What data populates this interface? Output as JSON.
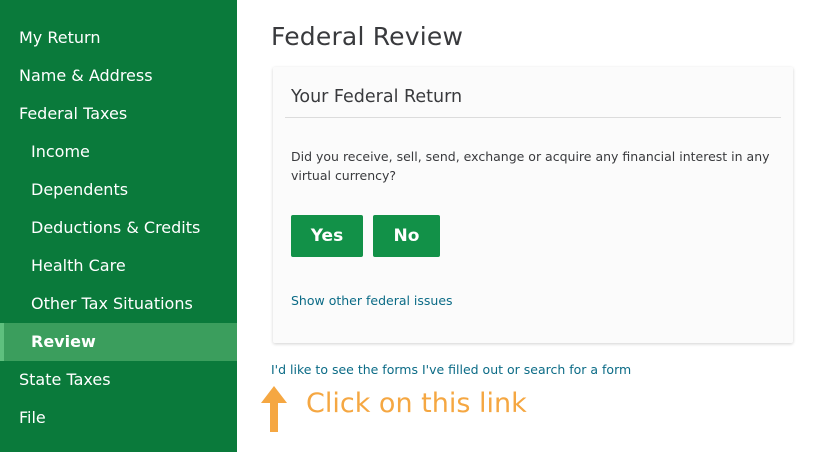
{
  "sidebar": {
    "items": [
      {
        "label": "My Return"
      },
      {
        "label": "Name & Address"
      },
      {
        "label": "Federal Taxes"
      },
      {
        "label": "Income"
      },
      {
        "label": "Dependents"
      },
      {
        "label": "Deductions & Credits"
      },
      {
        "label": "Health Care"
      },
      {
        "label": "Other Tax Situations"
      },
      {
        "label": "Review"
      },
      {
        "label": "State Taxes"
      },
      {
        "label": "File"
      }
    ],
    "active_item": "Review"
  },
  "main": {
    "page_title": "Federal Review",
    "card": {
      "title": "Your Federal Return",
      "question": "Did you receive, sell, send, exchange or acquire any financial interest in any virtual currency?",
      "yes_label": "Yes",
      "no_label": "No",
      "other_issues_link": "Show other federal issues"
    },
    "forms_link": "I'd like to see the forms I've filled out or search for a form",
    "annotation": "Click on this link"
  },
  "colors": {
    "sidebar_bg": "#0a7a3b",
    "active_item_bg": "#3b9e5d",
    "button_green": "#129148",
    "link": "#0b6b86",
    "annotation_orange": "#f5a742"
  },
  "icons": {
    "annotation_arrow": "arrow-up-icon"
  }
}
